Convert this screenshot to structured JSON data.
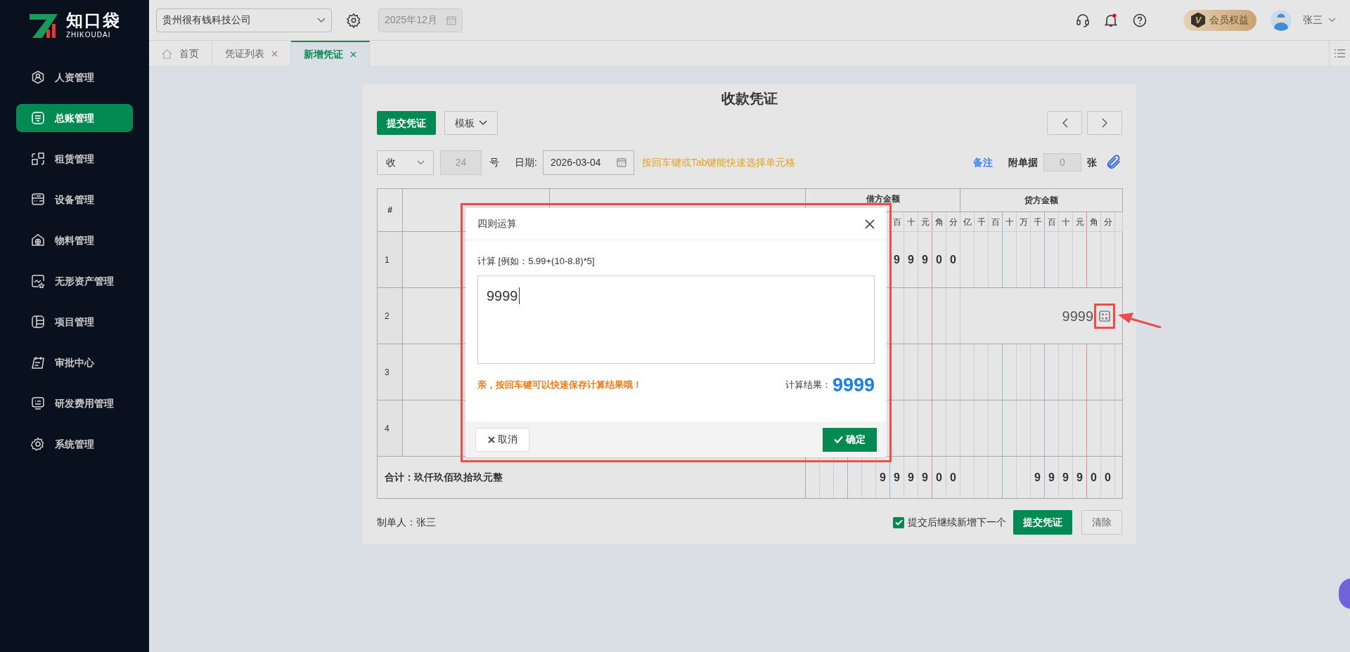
{
  "sidebar": {
    "logo_text": "知口袋",
    "logo_subtext": "ZHIKOUDAI",
    "items": [
      {
        "label": "人资管理",
        "selected": false
      },
      {
        "label": "总账管理",
        "selected": true
      },
      {
        "label": "租赁管理",
        "selected": false
      },
      {
        "label": "设备管理",
        "selected": false
      },
      {
        "label": "物料管理",
        "selected": false
      },
      {
        "label": "无形资产管理",
        "selected": false
      },
      {
        "label": "项目管理",
        "selected": false
      },
      {
        "label": "审批中心",
        "selected": false
      },
      {
        "label": "研发费用管理",
        "selected": false
      },
      {
        "label": "系统管理",
        "selected": false
      }
    ]
  },
  "header": {
    "company": "贵州很有钱科技公司",
    "period": "2025年12月",
    "member_badge": "V",
    "member_label": "会员权益",
    "user": "张三"
  },
  "tabs": [
    {
      "label": "首页",
      "closable": false,
      "selected": false
    },
    {
      "label": "凭证列表",
      "closable": true,
      "selected": false
    },
    {
      "label": "新增凭证",
      "closable": true,
      "selected": true
    }
  ],
  "voucher": {
    "title": "收款凭证",
    "submit_label": "提交凭证",
    "template_label": "模板",
    "type": "收",
    "number": "24",
    "number_suffix": "号",
    "date_label": "日期:",
    "date": "2026-03-04",
    "hint": "按回车键或Tab键能快速选择单元格",
    "note_link": "备注",
    "attachments_label": "附单据",
    "attachments": "0",
    "attachments_suffix": "张"
  },
  "table": {
    "index_header": "#",
    "debit_header": "借方金额",
    "credit_header": "贷方金额",
    "debit_units": [
      "百",
      "十",
      "元",
      "角",
      "分"
    ],
    "credit_units": [
      "亿",
      "千",
      "百",
      "十",
      "万",
      "千",
      "百",
      "十",
      "元",
      "角",
      "分"
    ],
    "rows": [
      {
        "index": "1",
        "debit_digits": [
          "9",
          "9",
          "9",
          "0",
          "0"
        ]
      },
      {
        "index": "2",
        "credit_input": "9999"
      },
      {
        "index": "3"
      },
      {
        "index": "4"
      }
    ],
    "total": {
      "label": "合计：玖仟玖佰玖拾玖元整",
      "debit_digits": [
        "9",
        "9",
        "9",
        "9",
        "0",
        "0"
      ],
      "credit_digits": [
        "9",
        "9",
        "9",
        "9",
        "0",
        "0"
      ]
    }
  },
  "footer": {
    "maker": "制单人：张三",
    "continue_label": "提交后继续新增下一个",
    "continue_checked": true,
    "submit_label": "提交凭证",
    "clear_label": "清除"
  },
  "dialog": {
    "title": "四则运算",
    "field_label": "计算 [例如：5.99+(10-8.8)*5]",
    "expression": "9999",
    "tip": "亲，按回车键可以快速保存计算结果哦！",
    "result_label": "计算结果：",
    "result": "9999",
    "cancel_label": "取消",
    "ok_label": "确定"
  }
}
